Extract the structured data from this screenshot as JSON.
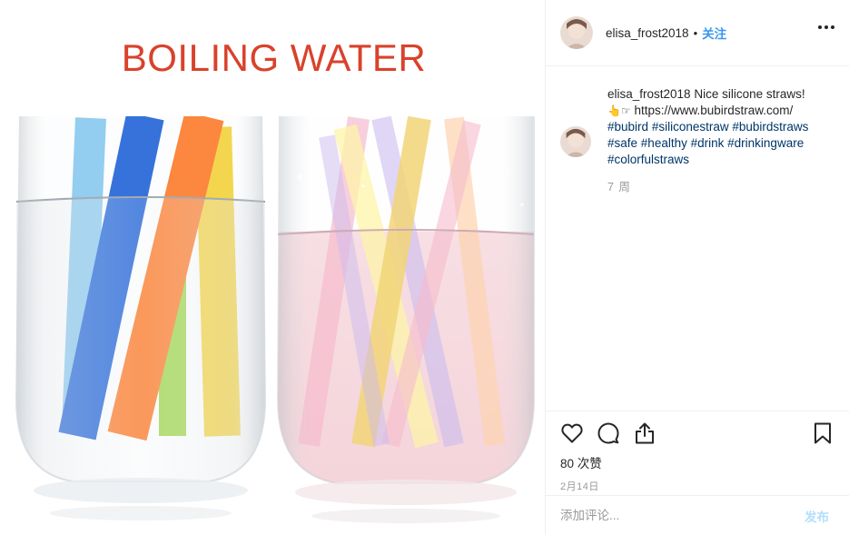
{
  "post": {
    "image": {
      "headline": "BOILING WATER",
      "headline_color": "#d9422b",
      "straw_colors_left": [
        "#7cc4ef",
        "#1f63d8",
        "#ff7a28",
        "#f5d33a",
        "#9ed64a"
      ],
      "straw_colors_right": [
        "#f2d26a",
        "#f7b6c9",
        "#c9b6ee",
        "#fff4a0",
        "#ffd0a8"
      ]
    }
  },
  "header": {
    "username": "elisa_frost2018",
    "separator": "•",
    "follow_label": "关注",
    "more_icon": "more-horizontal-icon"
  },
  "caption": {
    "username": "elisa_frost2018",
    "text": "Nice silicone straws!",
    "pointer_emoji": "👆☞",
    "link": "https://www.bubirdstraw.com/",
    "hashtags": [
      "#bubird",
      "#siliconestraw",
      "#bubirdstraws",
      "#safe",
      "#healthy",
      "#drink",
      "#drinkingware",
      "#colorfulstraws"
    ],
    "time_ago": "7 周"
  },
  "actions": {
    "like_icon": "heart-icon",
    "comment_icon": "comment-icon",
    "share_icon": "share-icon",
    "save_icon": "bookmark-icon",
    "likes_label": "80 次赞",
    "date": "2月14日"
  },
  "comment_box": {
    "placeholder": "添加评论...",
    "post_label": "发布",
    "post_color": "#b2dffc"
  },
  "colors": {
    "accent": "#3897f0",
    "text": "#262626",
    "muted": "#999999",
    "hashtag": "#003569",
    "border": "#efefef"
  }
}
